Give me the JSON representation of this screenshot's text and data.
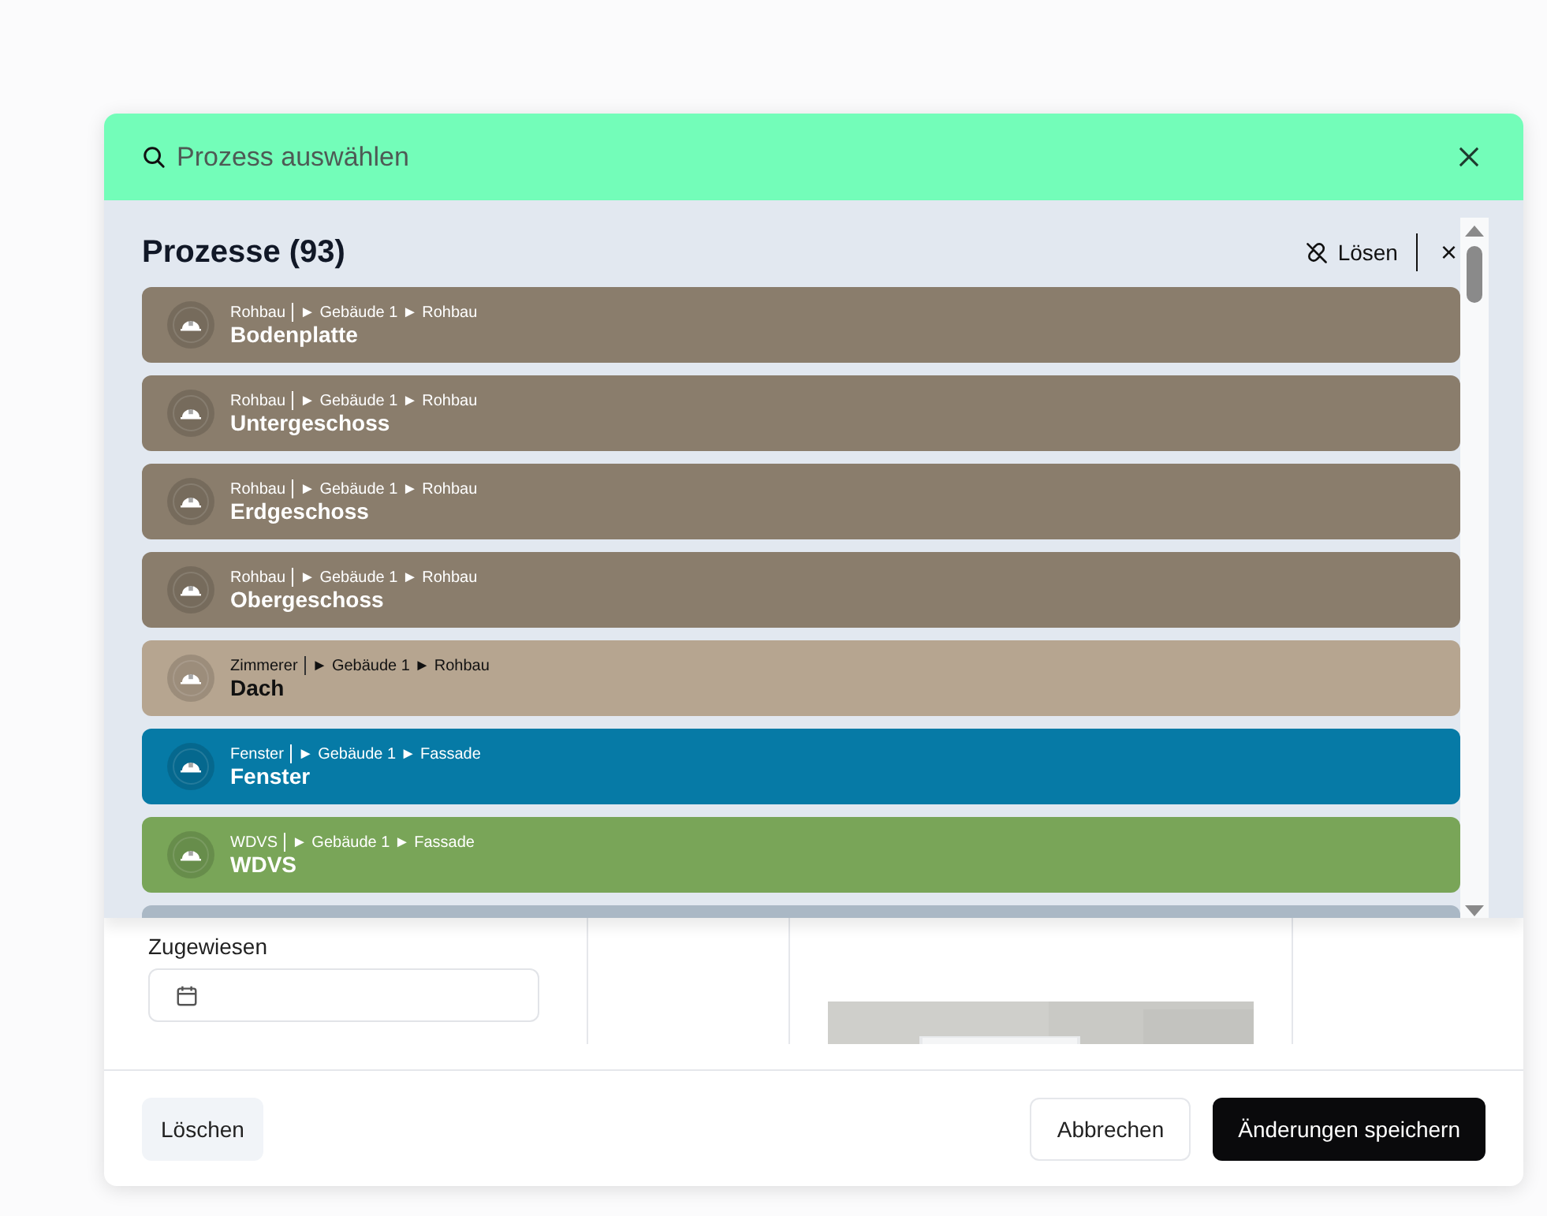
{
  "search": {
    "placeholder": "Prozess auswählen"
  },
  "list": {
    "title": "Prozesse (93)",
    "unlink_label": "Lösen",
    "clear_label": "×",
    "items": [
      {
        "trade": "Rohbau",
        "path": "► Gebäude 1 ► Rohbau",
        "name": "Bodenplatte",
        "color": "#8a7d6c"
      },
      {
        "trade": "Rohbau",
        "path": "► Gebäude 1 ► Rohbau",
        "name": "Untergeschoss",
        "color": "#8a7d6c"
      },
      {
        "trade": "Rohbau",
        "path": "► Gebäude 1 ► Rohbau",
        "name": "Erdgeschoss",
        "color": "#8a7d6c"
      },
      {
        "trade": "Rohbau",
        "path": "► Gebäude 1 ► Rohbau",
        "name": "Obergeschoss",
        "color": "#8a7d6c"
      },
      {
        "trade": "Zimmerer",
        "path": "► Gebäude 1 ► Rohbau",
        "name": "Dach",
        "color": "#b6a590"
      },
      {
        "trade": "Fenster",
        "path": "► Gebäude 1 ► Fassade",
        "name": "Fenster",
        "color": "#067aa6"
      },
      {
        "trade": "WDVS",
        "path": "► Gebäude 1 ► Fassade",
        "name": "WDVS",
        "color": "#79a558"
      },
      {
        "color": "#aab8c5"
      }
    ]
  },
  "form": {
    "assigned_label": "Zugewiesen"
  },
  "footer": {
    "delete": "Löschen",
    "cancel": "Abbrechen",
    "save": "Änderungen speichern"
  }
}
